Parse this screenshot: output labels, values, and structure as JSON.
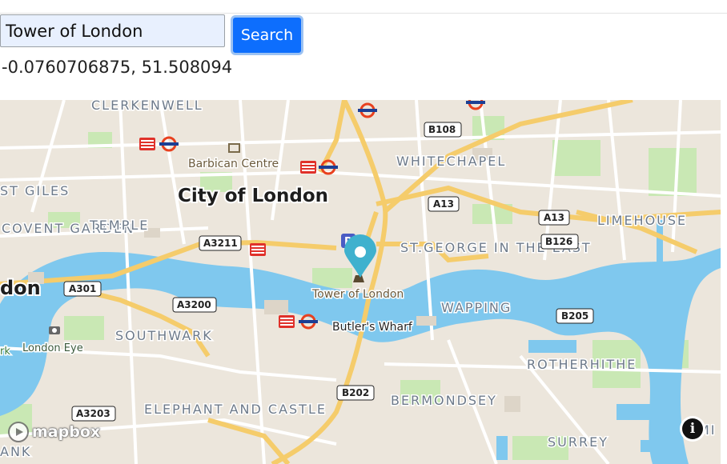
{
  "search": {
    "value": "Tower of London",
    "button_label": "Search"
  },
  "coordinates_text": "-0.0760706875, 51.508094",
  "map": {
    "colors": {
      "land": "#ece6dc",
      "water": "#7fc8ee",
      "park": "#c9e8b4",
      "major_road": "#f5cc6b",
      "minor_road": "#ffffff"
    },
    "district_labels": [
      "CLERKENWELL",
      "WHITECHAPEL",
      "ST GILES",
      "City of London",
      "COVENT GARDEN",
      "TEMPLE",
      "LIMEHOUSE",
      "ST.GEORGE IN THE EAST",
      "WAPPING",
      "SOUTHWARK",
      "ROTHERHITHE",
      "BERMONDSEY",
      "ELEPHANT AND CASTLE",
      "SURREY",
      "don",
      "ANK",
      "rk",
      "MI"
    ],
    "poi_labels": [
      "Barbican Centre",
      "Tower of London",
      "Butler's Wharf",
      "London Eye"
    ],
    "road_shields": [
      "B108",
      "A13",
      "A13",
      "B126",
      "A3211",
      "A301",
      "A3200",
      "B205",
      "B202",
      "A3203"
    ],
    "attribution_logo": "mapbox",
    "info_icon_glyph": "i",
    "marker_icon": "map-pin-icon"
  }
}
